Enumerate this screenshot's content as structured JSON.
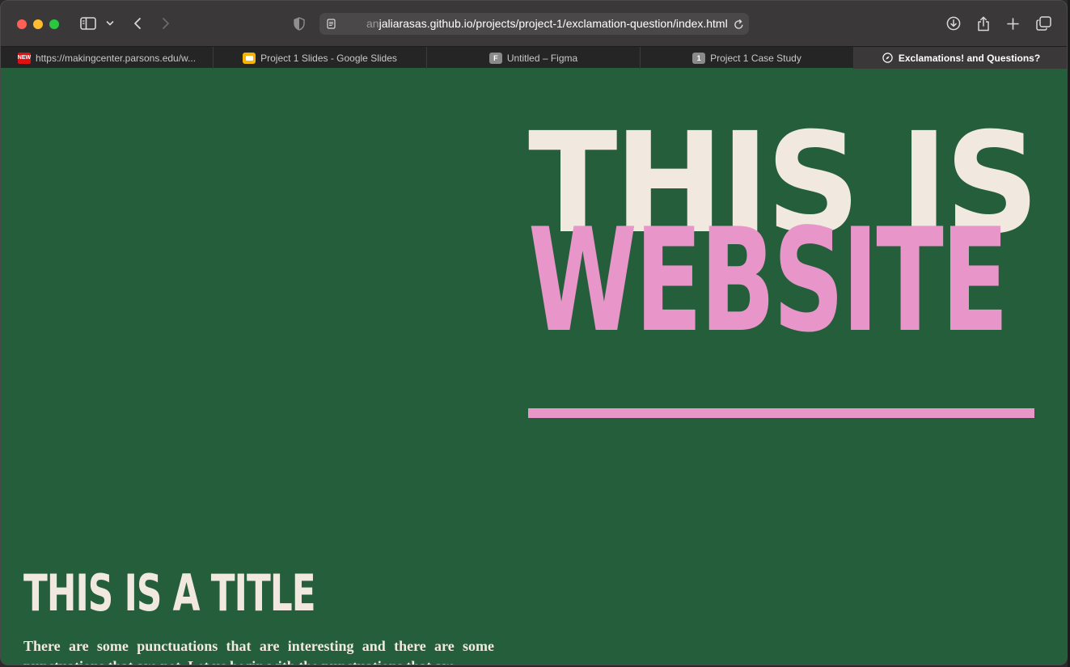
{
  "browser": {
    "url_prefix": "anjaliarasas.github.io",
    "url_dim": "an",
    "url_main": "jaliarasas.github.io/projects/project-1/exclamation-question/index.html",
    "tabs": [
      {
        "label": "https://makingcenter.parsons.edu/w...",
        "favicon": "new-badge-icon"
      },
      {
        "label": "Project 1 Slides - Google Slides",
        "favicon": "google-slides-icon"
      },
      {
        "label": "Untitled – Figma",
        "favicon": "figma-icon",
        "favicon_text": "F"
      },
      {
        "label": "Project 1 Case Study",
        "favicon": "number-icon",
        "favicon_text": "1"
      },
      {
        "label": "Exclamations! and Questions?",
        "favicon": "compass-icon"
      }
    ],
    "new_badge": "NEW"
  },
  "page": {
    "hero_line_1": "THIS IS A",
    "hero_line_2": "WEBSITE",
    "title": "THIS IS A TITLE",
    "body": "There are some punctuations that are interesting and there are some punctuations that are not. Let us begin with the punctuations that are"
  },
  "colors": {
    "background": "#255e3b",
    "cream": "#f1e9df",
    "pink": "#e895c9"
  }
}
